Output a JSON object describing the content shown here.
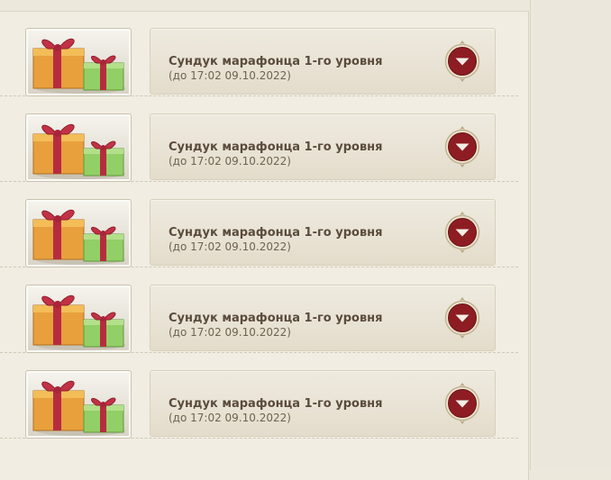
{
  "items": [
    {
      "title": "Сундук марафонца 1-го уровня",
      "subtitle": "(до 17:02 09.10.2022)",
      "icon": "gift-boxes-icon",
      "action_icon": "expand-down-icon"
    },
    {
      "title": "Сундук марафонца 1-го уровня",
      "subtitle": "(до 17:02 09.10.2022)",
      "icon": "gift-boxes-icon",
      "action_icon": "expand-down-icon"
    },
    {
      "title": "Сундук марафонца 1-го уровня",
      "subtitle": "(до 17:02 09.10.2022)",
      "icon": "gift-boxes-icon",
      "action_icon": "expand-down-icon"
    },
    {
      "title": "Сундук марафонца 1-го уровня",
      "subtitle": "(до 17:02 09.10.2022)",
      "icon": "gift-boxes-icon",
      "action_icon": "expand-down-icon"
    },
    {
      "title": "Сундук марафонца 1-го уровня",
      "subtitle": "(до 17:02 09.10.2022)",
      "icon": "gift-boxes-icon",
      "action_icon": "expand-down-icon"
    }
  ],
  "colors": {
    "page_bg": "#ede8dc",
    "card_bg": "#ebe6da",
    "title_text": "#5a4b3c",
    "button_red": "#8e1f24",
    "gift_orange": "#e9a23a",
    "gift_green": "#8fcc64",
    "ribbon_red": "#b32a3d"
  }
}
